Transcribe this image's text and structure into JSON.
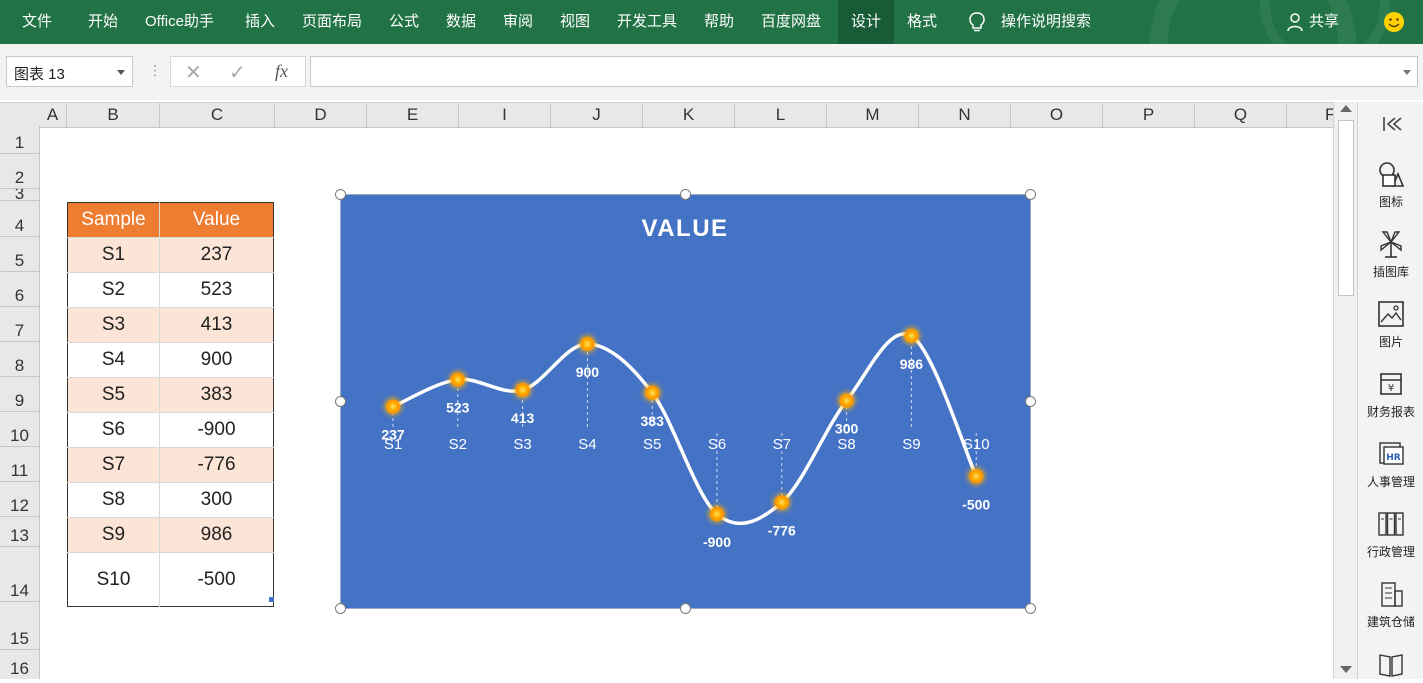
{
  "ribbon": {
    "tabs": [
      "文件",
      "开始",
      "Office助手",
      "插入",
      "页面布局",
      "公式",
      "数据",
      "审阅",
      "视图",
      "开发工具",
      "帮助",
      "百度网盘",
      "设计",
      "格式"
    ],
    "active_tabs": [
      "设计"
    ],
    "tell_me": "操作说明搜索",
    "share": "共享"
  },
  "formula_bar": {
    "name_box": "图表 13",
    "cancel_icon": "cancel-icon",
    "enter_icon": "check-icon",
    "fx_label": "fx",
    "formula": ""
  },
  "grid": {
    "columns": [
      "A",
      "B",
      "C",
      "D",
      "E",
      "I",
      "J",
      "K",
      "L",
      "M",
      "N",
      "O",
      "P",
      "Q",
      "F"
    ],
    "rows": [
      "1",
      "2",
      "3",
      "4",
      "5",
      "6",
      "7",
      "8",
      "9",
      "10",
      "11",
      "12",
      "13",
      "14",
      "15",
      "16"
    ]
  },
  "table": {
    "headers": [
      "Sample",
      "Value"
    ],
    "rows": [
      [
        "S1",
        "237"
      ],
      [
        "S2",
        "523"
      ],
      [
        "S3",
        "413"
      ],
      [
        "S4",
        "900"
      ],
      [
        "S5",
        "383"
      ],
      [
        "S6",
        "-900"
      ],
      [
        "S7",
        "-776"
      ],
      [
        "S8",
        "300"
      ],
      [
        "S9",
        "986"
      ],
      [
        "S10",
        "-500"
      ]
    ]
  },
  "chart_data": {
    "type": "line",
    "title": "VALUE",
    "categories": [
      "S1",
      "S2",
      "S3",
      "S4",
      "S5",
      "S6",
      "S7",
      "S8",
      "S9",
      "S10"
    ],
    "series": [
      {
        "values": [
          237,
          523,
          413,
          900,
          383,
          -900,
          -776,
          300,
          986,
          -500
        ]
      }
    ],
    "data_labels": [
      "237",
      "523",
      "413",
      "900",
      "383",
      "-900",
      "-776",
      "300",
      "986",
      "-500"
    ],
    "smooth": true,
    "legend": "none",
    "grid": false,
    "colors": {
      "background": "#4472c4",
      "line": "#ffffff",
      "marker": "#ffa500",
      "text": "#ffffff"
    }
  },
  "side_panel": {
    "collapse_icon": "collapse-icon",
    "items": [
      {
        "label": "图标",
        "icon": "shapes-icon"
      },
      {
        "label": "插图库",
        "icon": "windmill-icon"
      },
      {
        "label": "图片",
        "icon": "picture-icon"
      },
      {
        "label": "财务报表",
        "icon": "finance-icon"
      },
      {
        "label": "人事管理",
        "icon": "hr-icon"
      },
      {
        "label": "行政管理",
        "icon": "binder-icon"
      },
      {
        "label": "建筑仓储",
        "icon": "building-icon"
      },
      {
        "label": "",
        "icon": "book-icon"
      }
    ]
  }
}
